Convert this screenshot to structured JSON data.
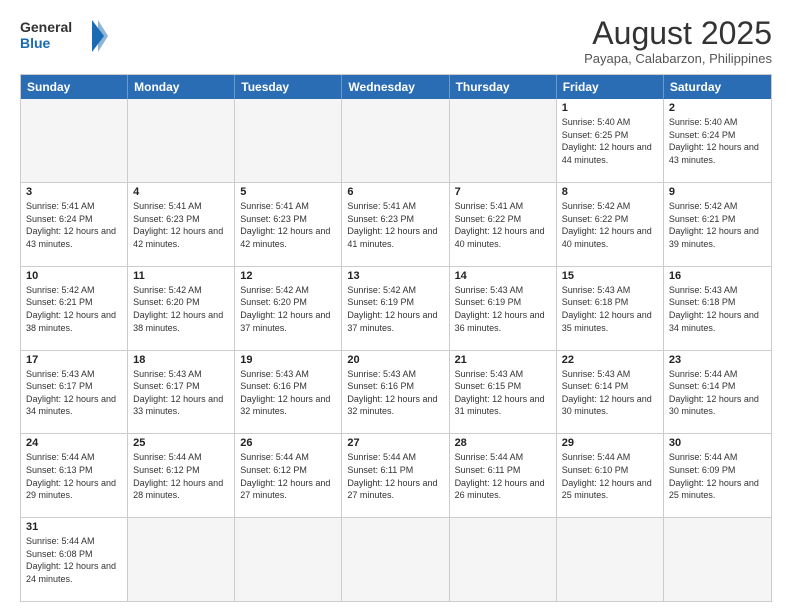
{
  "header": {
    "logo_general": "General",
    "logo_blue": "Blue",
    "month_year": "August 2025",
    "location": "Payapa, Calabarzon, Philippines"
  },
  "weekdays": [
    "Sunday",
    "Monday",
    "Tuesday",
    "Wednesday",
    "Thursday",
    "Friday",
    "Saturday"
  ],
  "rows": [
    [
      {
        "day": "",
        "info": ""
      },
      {
        "day": "",
        "info": ""
      },
      {
        "day": "",
        "info": ""
      },
      {
        "day": "",
        "info": ""
      },
      {
        "day": "",
        "info": ""
      },
      {
        "day": "1",
        "info": "Sunrise: 5:40 AM\nSunset: 6:25 PM\nDaylight: 12 hours and 44 minutes."
      },
      {
        "day": "2",
        "info": "Sunrise: 5:40 AM\nSunset: 6:24 PM\nDaylight: 12 hours and 43 minutes."
      }
    ],
    [
      {
        "day": "3",
        "info": "Sunrise: 5:41 AM\nSunset: 6:24 PM\nDaylight: 12 hours and 43 minutes."
      },
      {
        "day": "4",
        "info": "Sunrise: 5:41 AM\nSunset: 6:23 PM\nDaylight: 12 hours and 42 minutes."
      },
      {
        "day": "5",
        "info": "Sunrise: 5:41 AM\nSunset: 6:23 PM\nDaylight: 12 hours and 42 minutes."
      },
      {
        "day": "6",
        "info": "Sunrise: 5:41 AM\nSunset: 6:23 PM\nDaylight: 12 hours and 41 minutes."
      },
      {
        "day": "7",
        "info": "Sunrise: 5:41 AM\nSunset: 6:22 PM\nDaylight: 12 hours and 40 minutes."
      },
      {
        "day": "8",
        "info": "Sunrise: 5:42 AM\nSunset: 6:22 PM\nDaylight: 12 hours and 40 minutes."
      },
      {
        "day": "9",
        "info": "Sunrise: 5:42 AM\nSunset: 6:21 PM\nDaylight: 12 hours and 39 minutes."
      }
    ],
    [
      {
        "day": "10",
        "info": "Sunrise: 5:42 AM\nSunset: 6:21 PM\nDaylight: 12 hours and 38 minutes."
      },
      {
        "day": "11",
        "info": "Sunrise: 5:42 AM\nSunset: 6:20 PM\nDaylight: 12 hours and 38 minutes."
      },
      {
        "day": "12",
        "info": "Sunrise: 5:42 AM\nSunset: 6:20 PM\nDaylight: 12 hours and 37 minutes."
      },
      {
        "day": "13",
        "info": "Sunrise: 5:42 AM\nSunset: 6:19 PM\nDaylight: 12 hours and 37 minutes."
      },
      {
        "day": "14",
        "info": "Sunrise: 5:43 AM\nSunset: 6:19 PM\nDaylight: 12 hours and 36 minutes."
      },
      {
        "day": "15",
        "info": "Sunrise: 5:43 AM\nSunset: 6:18 PM\nDaylight: 12 hours and 35 minutes."
      },
      {
        "day": "16",
        "info": "Sunrise: 5:43 AM\nSunset: 6:18 PM\nDaylight: 12 hours and 34 minutes."
      }
    ],
    [
      {
        "day": "17",
        "info": "Sunrise: 5:43 AM\nSunset: 6:17 PM\nDaylight: 12 hours and 34 minutes."
      },
      {
        "day": "18",
        "info": "Sunrise: 5:43 AM\nSunset: 6:17 PM\nDaylight: 12 hours and 33 minutes."
      },
      {
        "day": "19",
        "info": "Sunrise: 5:43 AM\nSunset: 6:16 PM\nDaylight: 12 hours and 32 minutes."
      },
      {
        "day": "20",
        "info": "Sunrise: 5:43 AM\nSunset: 6:16 PM\nDaylight: 12 hours and 32 minutes."
      },
      {
        "day": "21",
        "info": "Sunrise: 5:43 AM\nSunset: 6:15 PM\nDaylight: 12 hours and 31 minutes."
      },
      {
        "day": "22",
        "info": "Sunrise: 5:43 AM\nSunset: 6:14 PM\nDaylight: 12 hours and 30 minutes."
      },
      {
        "day": "23",
        "info": "Sunrise: 5:44 AM\nSunset: 6:14 PM\nDaylight: 12 hours and 30 minutes."
      }
    ],
    [
      {
        "day": "24",
        "info": "Sunrise: 5:44 AM\nSunset: 6:13 PM\nDaylight: 12 hours and 29 minutes."
      },
      {
        "day": "25",
        "info": "Sunrise: 5:44 AM\nSunset: 6:12 PM\nDaylight: 12 hours and 28 minutes."
      },
      {
        "day": "26",
        "info": "Sunrise: 5:44 AM\nSunset: 6:12 PM\nDaylight: 12 hours and 27 minutes."
      },
      {
        "day": "27",
        "info": "Sunrise: 5:44 AM\nSunset: 6:11 PM\nDaylight: 12 hours and 27 minutes."
      },
      {
        "day": "28",
        "info": "Sunrise: 5:44 AM\nSunset: 6:11 PM\nDaylight: 12 hours and 26 minutes."
      },
      {
        "day": "29",
        "info": "Sunrise: 5:44 AM\nSunset: 6:10 PM\nDaylight: 12 hours and 25 minutes."
      },
      {
        "day": "30",
        "info": "Sunrise: 5:44 AM\nSunset: 6:09 PM\nDaylight: 12 hours and 25 minutes."
      }
    ],
    [
      {
        "day": "31",
        "info": "Sunrise: 5:44 AM\nSunset: 6:08 PM\nDaylight: 12 hours and 24 minutes."
      },
      {
        "day": "",
        "info": ""
      },
      {
        "day": "",
        "info": ""
      },
      {
        "day": "",
        "info": ""
      },
      {
        "day": "",
        "info": ""
      },
      {
        "day": "",
        "info": ""
      },
      {
        "day": "",
        "info": ""
      }
    ]
  ]
}
